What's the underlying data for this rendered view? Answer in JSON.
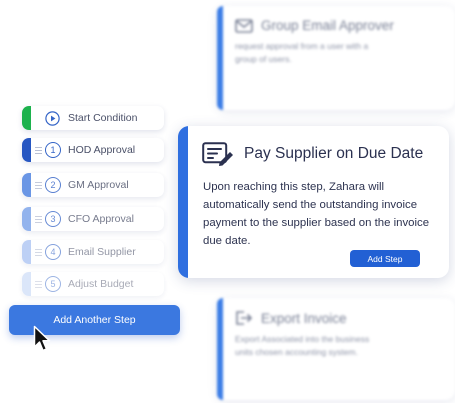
{
  "background_cards": {
    "top": {
      "icon": "mail-icon",
      "title": "Group Email Approver",
      "description": "request approval from a user with a group of users."
    },
    "bottom": {
      "icon": "export-icon",
      "title": "Export Invoice",
      "description": "Export Associated into the business units chosen accounting system."
    }
  },
  "steps": [
    {
      "number": "",
      "label": "Start Condition",
      "icon": "play-icon"
    },
    {
      "number": "1",
      "label": "HOD Approval"
    },
    {
      "number": "2",
      "label": "GM Approval"
    },
    {
      "number": "3",
      "label": "CFO Approval"
    },
    {
      "number": "4",
      "label": "Email Supplier"
    },
    {
      "number": "5",
      "label": "Adjust Budget"
    }
  ],
  "add_another_label": "Add Another Step",
  "detail_card": {
    "icon": "edit-document-icon",
    "title": "Pay Supplier on Due Date",
    "description": "Upon reaching this step, Zahara will automatically send the outstanding invoice payment to the supplier based on the invoice due date.",
    "button_label": "Add Step"
  },
  "colors": {
    "accent_blue": "#2f6fe0",
    "start_green": "#1db24d",
    "button_blue": "#2260d4"
  }
}
